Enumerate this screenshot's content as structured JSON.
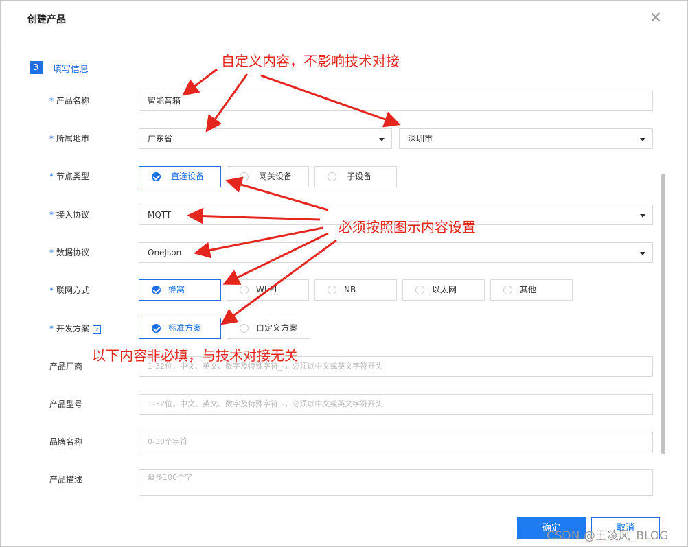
{
  "dialog": {
    "title": "创建产品",
    "close_icon": "close-icon",
    "step_number": "3",
    "step_title": "填写信息"
  },
  "form": {
    "product_name": {
      "label": "产品名称",
      "required": true,
      "value": "智能音箱"
    },
    "location": {
      "label": "所属地市",
      "required": true,
      "province": "广东省",
      "city": "深圳市"
    },
    "node_type": {
      "label": "节点类型",
      "required": true,
      "options": [
        "直连设备",
        "网关设备",
        "子设备"
      ],
      "selected": "直连设备"
    },
    "access_protocol": {
      "label": "接入协议",
      "required": true,
      "value": "MQTT"
    },
    "data_protocol": {
      "label": "数据协议",
      "required": true,
      "value": "OneJson"
    },
    "network": {
      "label": "联网方式",
      "required": true,
      "options": [
        "蜂窝",
        "WI-FI",
        "NB",
        "以太网",
        "其他"
      ],
      "selected": "蜂窝"
    },
    "dev_plan": {
      "label": "开发方案",
      "required": true,
      "help_icon": "?",
      "options": [
        "标准方案",
        "自定义方案"
      ],
      "selected": "标准方案"
    },
    "manufacturer": {
      "label": "产品厂商",
      "placeholder": "1-32位，中文、英文、数字及特殊字符_-，必须以中文或英文字符开头"
    },
    "model": {
      "label": "产品型号",
      "placeholder": "1-32位，中文、英文、数字及特殊字符_-，必须以中文或英文字符开头"
    },
    "brand": {
      "label": "品牌名称",
      "placeholder": "0-30个字符"
    },
    "description": {
      "label": "产品描述",
      "placeholder": "最多100个字"
    }
  },
  "footer": {
    "ok_label": "确定",
    "cancel_label": "取消"
  },
  "annotations": {
    "top": "自定义内容，不影响技术对接",
    "middle": "必须按照图示内容设置",
    "bottom": "以下内容非必填，与技术对接无关"
  },
  "watermark": "CSDN @王凌风_BLOG",
  "colors": {
    "accent": "#1f6fe5",
    "annotation": "#e5261f"
  }
}
